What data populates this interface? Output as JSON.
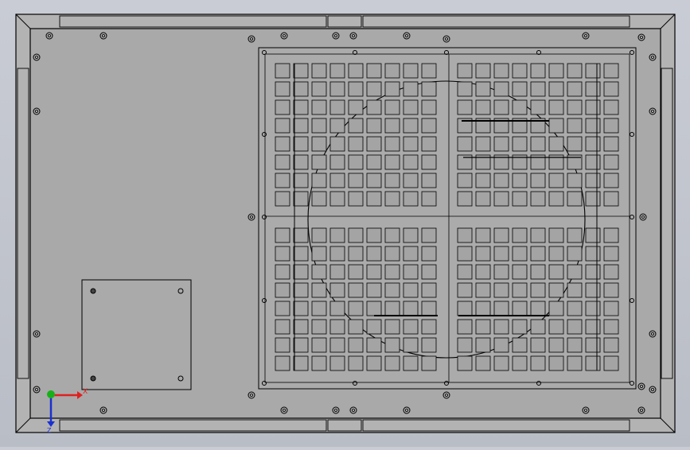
{
  "viewport": {
    "background": "#c0c3cb",
    "panel_fill": "#a9a9a9",
    "frame_fill": "#b3b3b3",
    "line_color": "#000000"
  },
  "axes_triad": {
    "x_label": "X",
    "x_color": "#e02020",
    "y_color": "#18b018",
    "z_color": "#1a2fd0",
    "z_label": "Z"
  }
}
